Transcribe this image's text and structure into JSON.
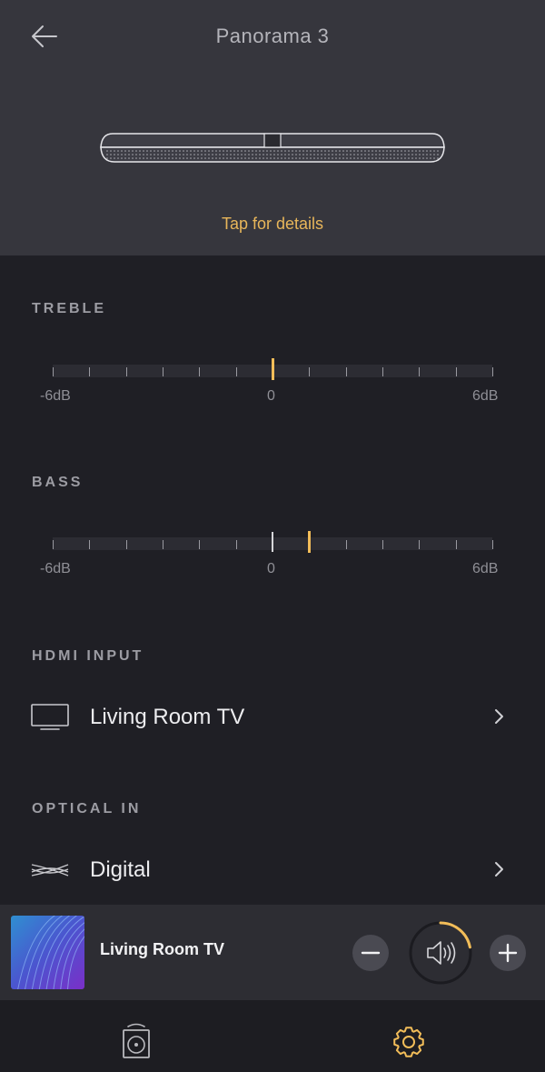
{
  "header": {
    "title": "Panorama 3",
    "details_link": "Tap for details",
    "back_icon": "arrow-left-icon",
    "device_image": "soundbar"
  },
  "treble": {
    "label": "TREBLE",
    "min_label": "-6dB",
    "center_label": "0",
    "max_label": "6dB",
    "min": -6,
    "max": 6,
    "value": 0
  },
  "bass": {
    "label": "BASS",
    "min_label": "-6dB",
    "center_label": "0",
    "max_label": "6dB",
    "min": -6,
    "max": 6,
    "value": 1
  },
  "hdmi": {
    "label": "HDMI INPUT",
    "value": "Living Room TV",
    "icon": "tv-icon"
  },
  "optical": {
    "label": "OPTICAL IN",
    "value": "Digital",
    "icon": "optical-cable-icon"
  },
  "player": {
    "now_playing": "Living Room TV",
    "volume_level": 0.22,
    "icons": [
      "minus-icon",
      "speaker-icon",
      "plus-icon"
    ]
  },
  "tabs": [
    "speaker-icon",
    "settings-gear-icon"
  ],
  "colors": {
    "accent": "#f2bd59",
    "header_bg": "#36363d",
    "body_bg": "#1f1f25",
    "player_bg": "#2d2d33",
    "tabbar_bg": "#1d1d22"
  }
}
